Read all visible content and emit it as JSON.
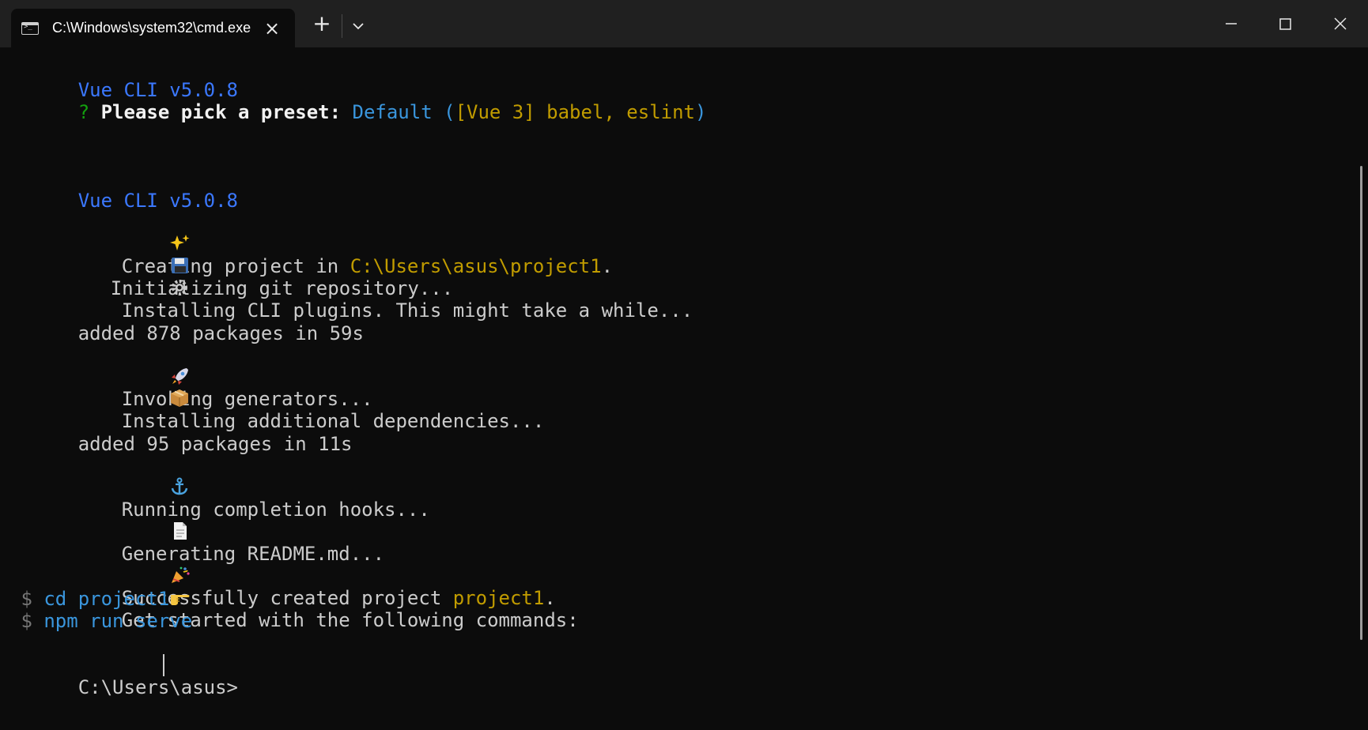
{
  "titlebar": {
    "tab_title": "C:\\Windows\\system32\\cmd.exe",
    "close_tab_icon": "close-icon",
    "new_tab_icon": "plus-icon",
    "dropdown_icon": "chevron-down-icon",
    "minimize_icon": "minimize-icon",
    "maximize_icon": "maximize-icon",
    "close_window_icon": "close-icon"
  },
  "terminal": {
    "lines": [
      {
        "parts": [
          "Vue CLI v5.0.8"
        ]
      },
      {
        "parts": [
          "?",
          " Please pick a preset: ",
          "Default",
          " (",
          "[Vue 3] babel, eslint",
          ")"
        ]
      },
      {
        "parts": [
          "Vue CLI v5.0.8"
        ]
      },
      {
        "icon": "sparkles-icon",
        "parts": [
          "Creating project in ",
          "C:\\Users\\asus\\project1",
          "."
        ]
      },
      {
        "icon": "floppy-disk-icon",
        "parts": [
          "Initializing git repository..."
        ]
      },
      {
        "icon": "gear-icon",
        "parts": [
          "Installing CLI plugins. This might take a while..."
        ]
      },
      {
        "parts": [
          "added 878 packages in 59s"
        ]
      },
      {
        "icon": "rocket-icon",
        "parts": [
          "Invoking generators..."
        ]
      },
      {
        "icon": "package-icon",
        "parts": [
          "Installing additional dependencies..."
        ]
      },
      {
        "parts": [
          "added 95 packages in 11s"
        ]
      },
      {
        "icon": "anchor-icon",
        "parts": [
          "Running completion hooks..."
        ]
      },
      {
        "icon": "document-icon",
        "parts": [
          "Generating README.md..."
        ]
      },
      {
        "icon": "party-popper-icon",
        "parts": [
          "Successfully created project ",
          "project1",
          "."
        ]
      },
      {
        "icon": "pointing-hand-icon",
        "parts": [
          "Get started with the following commands:"
        ]
      },
      {
        "parts": [
          "$",
          "cd project1"
        ]
      },
      {
        "parts": [
          "$",
          "npm run serve"
        ]
      },
      {
        "parts": [
          "C:\\Users\\asus>"
        ]
      }
    ]
  },
  "colors": {
    "background": "#0c0c0c",
    "titlebar": "#202020",
    "default_text": "#cccccc",
    "blue": "#3b78ff",
    "cyan": "#3a96dd",
    "yellow": "#c19c00",
    "green": "#13a10e"
  }
}
